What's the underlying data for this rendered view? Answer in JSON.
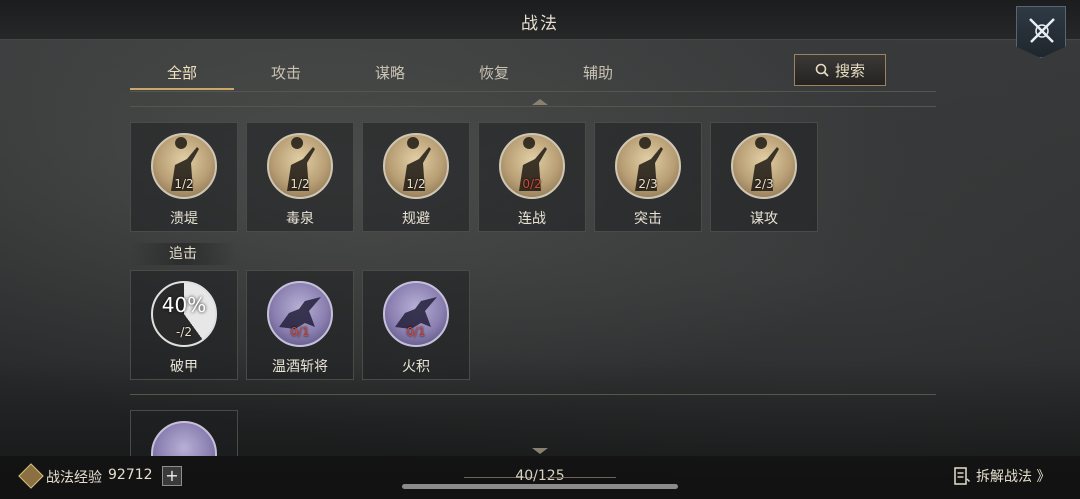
{
  "header": {
    "title": "战法"
  },
  "tabs": [
    {
      "label": "全部",
      "active": true
    },
    {
      "label": "攻击",
      "active": false
    },
    {
      "label": "谋略",
      "active": false
    },
    {
      "label": "恢复",
      "active": false
    },
    {
      "label": "辅助",
      "active": false
    }
  ],
  "search": {
    "label": "搜索"
  },
  "row1": [
    {
      "name": "溃堤",
      "count": "1/2",
      "tier": "gold"
    },
    {
      "name": "毒泉",
      "count": "1/2",
      "tier": "gold"
    },
    {
      "name": "规避",
      "count": "1/2",
      "tier": "gold"
    },
    {
      "name": "连战",
      "count": "0/2",
      "tier": "gold",
      "count_red": true
    },
    {
      "name": "突击",
      "count": "2/3",
      "tier": "gold"
    },
    {
      "name": "谋攻",
      "count": "2/3",
      "tier": "gold"
    }
  ],
  "group_label": "追击",
  "row2": [
    {
      "name": "破甲",
      "count": "-/2",
      "tier": "gray",
      "progress": "40%"
    },
    {
      "name": "温酒斩将",
      "count": "0/1",
      "tier": "purple",
      "count_red": true
    },
    {
      "name": "火积",
      "count": "0/1",
      "tier": "purple",
      "count_red": true
    }
  ],
  "footer": {
    "exp_label": "战法经验",
    "exp_value": "92712",
    "plus_label": "+",
    "page": "40/125",
    "decompose_label": "拆解战法 》"
  },
  "colors": {
    "accent": "#c9a86a",
    "red_count": "#d0463a",
    "purple_icon": "#8a7fb0"
  },
  "icons": [
    "crossed-swords-icon",
    "search-icon",
    "plus-icon",
    "decompose-icon"
  ]
}
